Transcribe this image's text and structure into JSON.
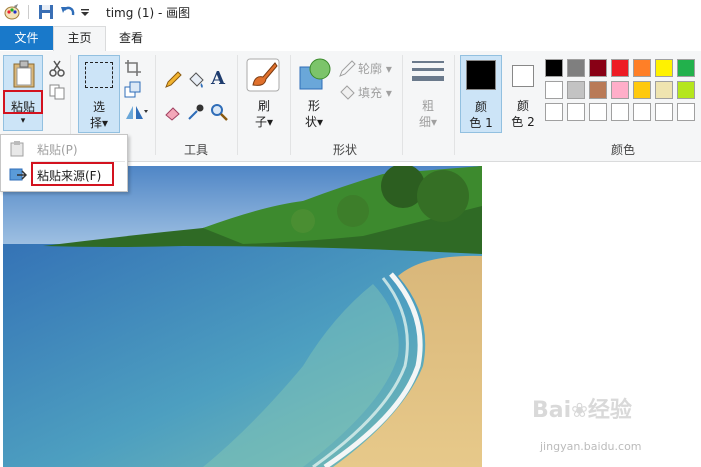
{
  "titlebar": {
    "title": "timg (1) - 画图"
  },
  "tabs": {
    "file": "文件",
    "home": "主页",
    "view": "查看"
  },
  "clipboard": {
    "paste_label": "粘贴",
    "paste_arrow": "▾"
  },
  "image_group": {
    "select_line1": "选",
    "select_line2": "择▾"
  },
  "tools_group": {
    "label": "工具",
    "text_tool": "A"
  },
  "brushes": {
    "line1": "刷",
    "line2": "子▾"
  },
  "shapes_group": {
    "shape_line1": "形",
    "shape_line2": "状▾",
    "outline": "轮廓",
    "fill": "填充",
    "label": "形状"
  },
  "size": {
    "line1": "粗",
    "line2": "细▾"
  },
  "colors_group": {
    "color1_line1": "颜",
    "color1_line2": "色 1",
    "color2_line1": "颜",
    "color2_line2": "色 2",
    "label": "颜色",
    "color1": "#000000",
    "color2": "#ffffff",
    "palette_row1": [
      "#000000",
      "#7f7f7f",
      "#880015",
      "#ed1c24",
      "#ff7f27",
      "#fff200",
      "#22b14c"
    ],
    "palette_row2": [
      "#ffffff",
      "#c3c3c3",
      "#b97a57",
      "#ffaec9",
      "#ffc90e",
      "#efe4b0",
      "#b5e61d"
    ],
    "palette_row3": [
      "#ffffff",
      "#ffffff",
      "#ffffff",
      "#ffffff",
      "#ffffff",
      "#ffffff",
      "#ffffff"
    ]
  },
  "paste_menu": {
    "paste": "粘贴(P)",
    "paste_from": "粘贴来源(F)"
  },
  "watermark": {
    "brand": "Bai",
    "brand2": "经验",
    "url": "jingyan.baidu.com"
  },
  "accent": "#1979ca",
  "highlight_color": "#d3121f"
}
